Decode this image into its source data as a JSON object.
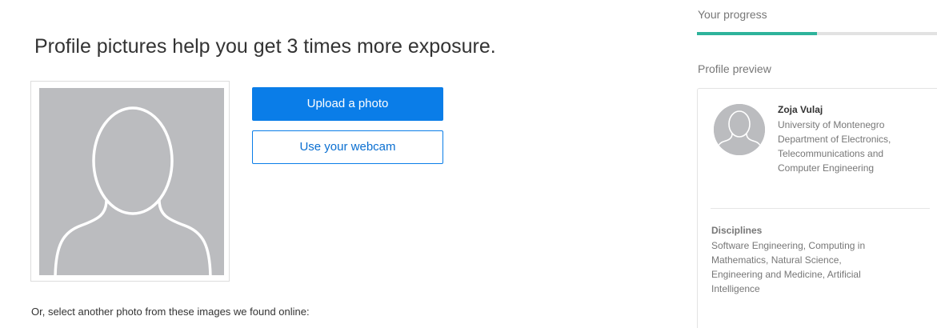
{
  "main": {
    "headline": "Profile pictures help you get 3 times more exposure.",
    "upload_button": "Upload a photo",
    "webcam_button": "Use your webcam",
    "select_other": "Or, select another photo from these images we found online:"
  },
  "sidebar": {
    "progress_label": "Your progress",
    "progress_fraction": 0.5,
    "preview_label": "Profile preview",
    "card": {
      "name": "Zoja Vulaj",
      "affiliation_lines": [
        "University of Montenegro",
        "Department of Electronics,",
        "Telecommunications and",
        "Computer Engineering"
      ],
      "disciplines_label": "Disciplines",
      "disciplines_lines": [
        "Software Engineering, Computing in",
        "Mathematics, Natural Science,",
        "Engineering and Medicine, Artificial",
        "Intelligence"
      ]
    }
  },
  "colors": {
    "accent": "#0a7de8",
    "progress": "#2eb39b",
    "placeholder": "#bbbcbf"
  },
  "icons": {
    "photo_placeholder": "user-silhouette-icon",
    "avatar": "user-avatar-icon"
  }
}
